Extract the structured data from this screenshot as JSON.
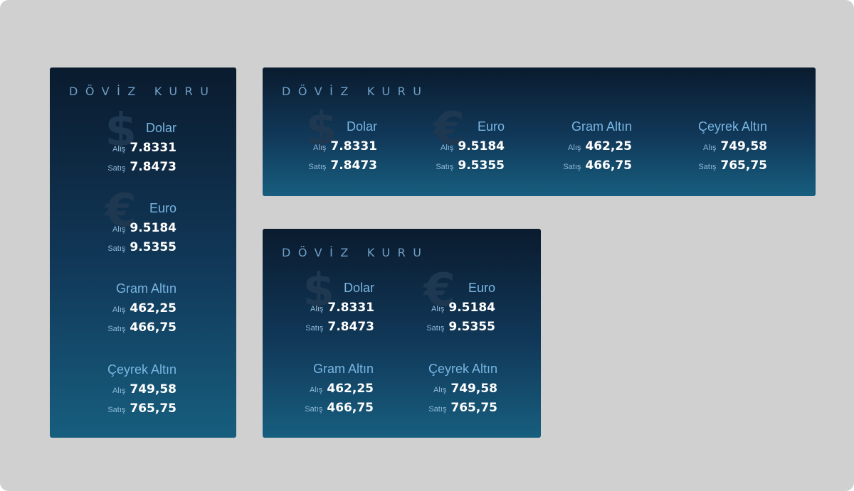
{
  "title": "DÖVİZ KURU",
  "labels": {
    "buy": "Alış",
    "sell": "Satış"
  },
  "currencies": {
    "dolar": {
      "name": "Dolar",
      "symbol": "$",
      "buy": "7.8331",
      "sell": "7.8473"
    },
    "euro": {
      "name": "Euro",
      "symbol": "€",
      "buy": "9.5184",
      "sell": "9.5355"
    },
    "gram": {
      "name": "Gram Altın",
      "symbol": "",
      "buy": "462,25",
      "sell": "466,75"
    },
    "ceyrek": {
      "name": "Çeyrek Altın",
      "symbol": "",
      "buy": "749,58",
      "sell": "765,75"
    }
  },
  "colors": {
    "frame_bg": "#d0d0d0",
    "gradient_top": "#0a1b2e",
    "gradient_bottom": "#175e7e",
    "title": "#6f9fc7",
    "currency_name": "#79b6e3",
    "value": "#ffffff"
  }
}
